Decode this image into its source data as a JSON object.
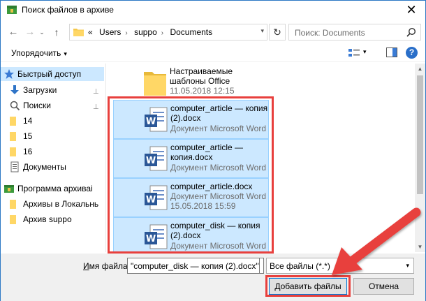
{
  "window": {
    "title": "Поиск файлов в архиве",
    "close_glyph": "✕"
  },
  "nav": {
    "back_glyph": "←",
    "forward_glyph": "→",
    "recent_glyph": "⌄",
    "up_glyph": "↑",
    "refresh_glyph": "↻"
  },
  "address": {
    "overflow_glyph": "«",
    "crumbs": [
      "Users",
      "suppo",
      "Documents"
    ],
    "crumb_separator": "›"
  },
  "search": {
    "placeholder": "Поиск: Documents"
  },
  "toolbar": {
    "organize_label": "Упорядочить",
    "help_glyph": "?"
  },
  "navpane": {
    "items": [
      {
        "label": "Быстрый доступ",
        "icon": "star-icon",
        "selected": true
      },
      {
        "label": "Загрузки",
        "icon": "download-icon",
        "pinned": true
      },
      {
        "label": "Поиски",
        "icon": "search-icon",
        "pinned": true
      },
      {
        "label": "14",
        "icon": "folder-icon"
      },
      {
        "label": "15",
        "icon": "folder-icon"
      },
      {
        "label": "16",
        "icon": "folder-icon"
      },
      {
        "label": "Документы",
        "icon": "documents-icon"
      },
      {
        "label": "Программа архиваі",
        "icon": "archiver-icon"
      },
      {
        "label": "Архивы в Локальнь",
        "icon": "folder-icon"
      },
      {
        "label": "Архив suppo",
        "icon": "folder-icon"
      }
    ],
    "pin_glyph": "📌"
  },
  "files": [
    {
      "name": "Настраиваемые шаблоны Office",
      "meta1": "11.05.2018 12:15",
      "meta2": "",
      "type": "folder",
      "selected": false
    },
    {
      "name": "computer_article — копия (2).docx",
      "meta1": "Документ Microsoft Word",
      "meta2": "",
      "type": "word",
      "selected": true
    },
    {
      "name": "computer_article — копия.docx",
      "meta1": "Документ Microsoft Word",
      "meta2": "",
      "type": "word",
      "selected": true
    },
    {
      "name": "computer_article.docx",
      "meta1": "Документ Microsoft Word",
      "meta2": "15.05.2018 15:59",
      "type": "word",
      "selected": true
    },
    {
      "name": "computer_disk — копия (2).docx",
      "meta1": "Документ Microsoft Word",
      "meta2": "",
      "type": "word",
      "selected": true
    }
  ],
  "bottom": {
    "filename_label_underlined": "И",
    "filename_label_rest": "мя файла:",
    "filename_value": "\"computer_disk — копия (2).docx\"",
    "filetype_value": "Все файлы (*.*)",
    "add_button": "Добавить файлы",
    "cancel_button": "Отмена"
  },
  "colors": {
    "accent_red": "#e8403d",
    "selection": "#cce8ff",
    "word_blue": "#2b5797"
  }
}
